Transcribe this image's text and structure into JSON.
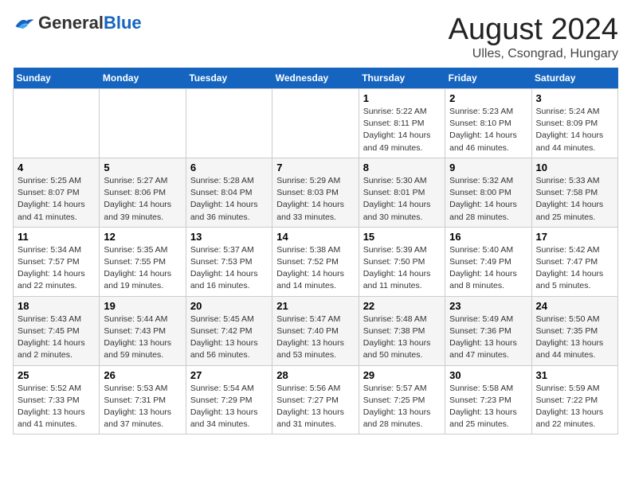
{
  "header": {
    "logo_general": "General",
    "logo_blue": "Blue",
    "title": "August 2024",
    "subtitle": "Ulles, Csongrad, Hungary"
  },
  "calendar": {
    "days_of_week": [
      "Sunday",
      "Monday",
      "Tuesday",
      "Wednesday",
      "Thursday",
      "Friday",
      "Saturday"
    ],
    "weeks": [
      {
        "cells": [
          {
            "day": "",
            "content": ""
          },
          {
            "day": "",
            "content": ""
          },
          {
            "day": "",
            "content": ""
          },
          {
            "day": "",
            "content": ""
          },
          {
            "day": "1",
            "content": "Sunrise: 5:22 AM\nSunset: 8:11 PM\nDaylight: 14 hours\nand 49 minutes."
          },
          {
            "day": "2",
            "content": "Sunrise: 5:23 AM\nSunset: 8:10 PM\nDaylight: 14 hours\nand 46 minutes."
          },
          {
            "day": "3",
            "content": "Sunrise: 5:24 AM\nSunset: 8:09 PM\nDaylight: 14 hours\nand 44 minutes."
          }
        ]
      },
      {
        "cells": [
          {
            "day": "4",
            "content": "Sunrise: 5:25 AM\nSunset: 8:07 PM\nDaylight: 14 hours\nand 41 minutes."
          },
          {
            "day": "5",
            "content": "Sunrise: 5:27 AM\nSunset: 8:06 PM\nDaylight: 14 hours\nand 39 minutes."
          },
          {
            "day": "6",
            "content": "Sunrise: 5:28 AM\nSunset: 8:04 PM\nDaylight: 14 hours\nand 36 minutes."
          },
          {
            "day": "7",
            "content": "Sunrise: 5:29 AM\nSunset: 8:03 PM\nDaylight: 14 hours\nand 33 minutes."
          },
          {
            "day": "8",
            "content": "Sunrise: 5:30 AM\nSunset: 8:01 PM\nDaylight: 14 hours\nand 30 minutes."
          },
          {
            "day": "9",
            "content": "Sunrise: 5:32 AM\nSunset: 8:00 PM\nDaylight: 14 hours\nand 28 minutes."
          },
          {
            "day": "10",
            "content": "Sunrise: 5:33 AM\nSunset: 7:58 PM\nDaylight: 14 hours\nand 25 minutes."
          }
        ]
      },
      {
        "cells": [
          {
            "day": "11",
            "content": "Sunrise: 5:34 AM\nSunset: 7:57 PM\nDaylight: 14 hours\nand 22 minutes."
          },
          {
            "day": "12",
            "content": "Sunrise: 5:35 AM\nSunset: 7:55 PM\nDaylight: 14 hours\nand 19 minutes."
          },
          {
            "day": "13",
            "content": "Sunrise: 5:37 AM\nSunset: 7:53 PM\nDaylight: 14 hours\nand 16 minutes."
          },
          {
            "day": "14",
            "content": "Sunrise: 5:38 AM\nSunset: 7:52 PM\nDaylight: 14 hours\nand 14 minutes."
          },
          {
            "day": "15",
            "content": "Sunrise: 5:39 AM\nSunset: 7:50 PM\nDaylight: 14 hours\nand 11 minutes."
          },
          {
            "day": "16",
            "content": "Sunrise: 5:40 AM\nSunset: 7:49 PM\nDaylight: 14 hours\nand 8 minutes."
          },
          {
            "day": "17",
            "content": "Sunrise: 5:42 AM\nSunset: 7:47 PM\nDaylight: 14 hours\nand 5 minutes."
          }
        ]
      },
      {
        "cells": [
          {
            "day": "18",
            "content": "Sunrise: 5:43 AM\nSunset: 7:45 PM\nDaylight: 14 hours\nand 2 minutes."
          },
          {
            "day": "19",
            "content": "Sunrise: 5:44 AM\nSunset: 7:43 PM\nDaylight: 13 hours\nand 59 minutes."
          },
          {
            "day": "20",
            "content": "Sunrise: 5:45 AM\nSunset: 7:42 PM\nDaylight: 13 hours\nand 56 minutes."
          },
          {
            "day": "21",
            "content": "Sunrise: 5:47 AM\nSunset: 7:40 PM\nDaylight: 13 hours\nand 53 minutes."
          },
          {
            "day": "22",
            "content": "Sunrise: 5:48 AM\nSunset: 7:38 PM\nDaylight: 13 hours\nand 50 minutes."
          },
          {
            "day": "23",
            "content": "Sunrise: 5:49 AM\nSunset: 7:36 PM\nDaylight: 13 hours\nand 47 minutes."
          },
          {
            "day": "24",
            "content": "Sunrise: 5:50 AM\nSunset: 7:35 PM\nDaylight: 13 hours\nand 44 minutes."
          }
        ]
      },
      {
        "cells": [
          {
            "day": "25",
            "content": "Sunrise: 5:52 AM\nSunset: 7:33 PM\nDaylight: 13 hours\nand 41 minutes."
          },
          {
            "day": "26",
            "content": "Sunrise: 5:53 AM\nSunset: 7:31 PM\nDaylight: 13 hours\nand 37 minutes."
          },
          {
            "day": "27",
            "content": "Sunrise: 5:54 AM\nSunset: 7:29 PM\nDaylight: 13 hours\nand 34 minutes."
          },
          {
            "day": "28",
            "content": "Sunrise: 5:56 AM\nSunset: 7:27 PM\nDaylight: 13 hours\nand 31 minutes."
          },
          {
            "day": "29",
            "content": "Sunrise: 5:57 AM\nSunset: 7:25 PM\nDaylight: 13 hours\nand 28 minutes."
          },
          {
            "day": "30",
            "content": "Sunrise: 5:58 AM\nSunset: 7:23 PM\nDaylight: 13 hours\nand 25 minutes."
          },
          {
            "day": "31",
            "content": "Sunrise: 5:59 AM\nSunset: 7:22 PM\nDaylight: 13 hours\nand 22 minutes."
          }
        ]
      }
    ]
  }
}
